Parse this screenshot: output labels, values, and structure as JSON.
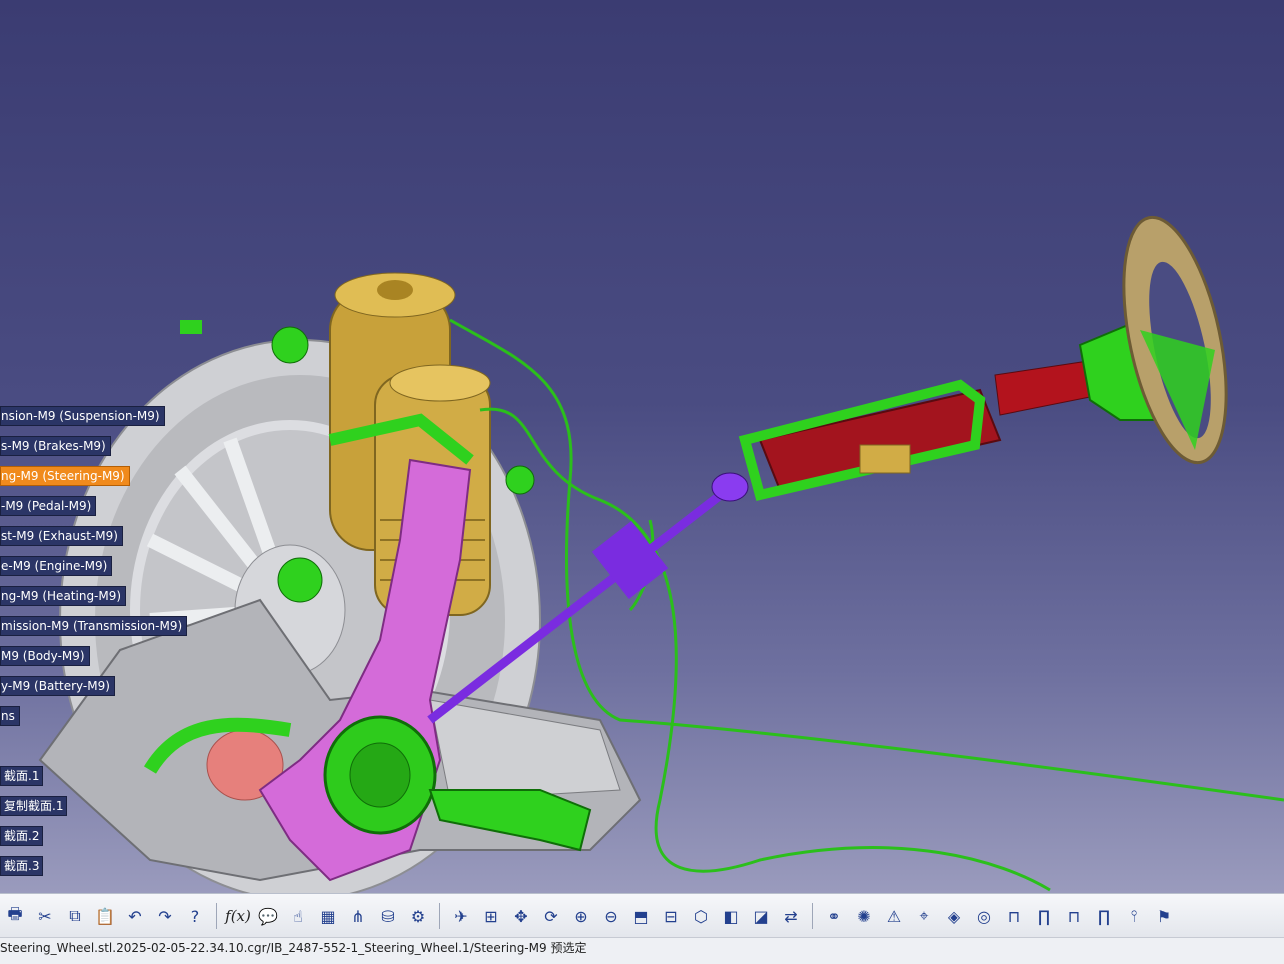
{
  "spec_tree": {
    "items": [
      {
        "label": "nsion-M9 (Suspension-M9)"
      },
      {
        "label": "s-M9 (Brakes-M9)"
      },
      {
        "label": "ng-M9 (Steering-M9)",
        "selected": true
      },
      {
        "label": "-M9 (Pedal-M9)"
      },
      {
        "label": "st-M9 (Exhaust-M9)"
      },
      {
        "label": "e-M9 (Engine-M9)"
      },
      {
        "label": "ng-M9 (Heating-M9)"
      },
      {
        "label": "mission-M9 (Transmission-M9)"
      },
      {
        "label": "M9 (Body-M9)"
      },
      {
        "label": "y-M9 (Battery-M9)"
      },
      {
        "label": "ns"
      }
    ],
    "sections": [
      {
        "label": "截面.1"
      },
      {
        "label": "复制截面.1"
      },
      {
        "label": "截面.2"
      },
      {
        "label": "截面.3"
      }
    ]
  },
  "toolbar": {
    "buttons": [
      {
        "name": "print-icon",
        "glyph": "🖶"
      },
      {
        "name": "cut-icon",
        "glyph": "✂"
      },
      {
        "name": "copy-icon",
        "glyph": "⧉"
      },
      {
        "name": "paste-icon",
        "glyph": "📋"
      },
      {
        "name": "undo-icon",
        "glyph": "↶"
      },
      {
        "name": "redo-icon",
        "glyph": "↷"
      },
      {
        "name": "whats-this-icon",
        "glyph": "?"
      },
      {
        "name": "sep"
      },
      {
        "name": "formula-icon",
        "glyph": "f(x)",
        "fx": true
      },
      {
        "name": "comment-icon",
        "glyph": "💬"
      },
      {
        "name": "hand-icon",
        "glyph": "☝"
      },
      {
        "name": "table-icon",
        "glyph": "▦"
      },
      {
        "name": "tree-icon",
        "glyph": "⋔"
      },
      {
        "name": "catalog-icon",
        "glyph": "⛁"
      },
      {
        "name": "knowledge-icon",
        "glyph": "⚙"
      },
      {
        "name": "sep"
      },
      {
        "name": "fly-mode-icon",
        "glyph": "✈"
      },
      {
        "name": "fit-all-icon",
        "glyph": "⊞"
      },
      {
        "name": "pan-icon",
        "glyph": "✥"
      },
      {
        "name": "rotate-icon",
        "glyph": "⟳"
      },
      {
        "name": "zoom-in-icon",
        "glyph": "⊕"
      },
      {
        "name": "zoom-out-icon",
        "glyph": "⊖"
      },
      {
        "name": "normal-view-icon",
        "glyph": "⬒"
      },
      {
        "name": "multi-view-icon",
        "glyph": "⊟"
      },
      {
        "name": "iso-view-icon",
        "glyph": "⬡"
      },
      {
        "name": "shading-icon",
        "glyph": "◧"
      },
      {
        "name": "hide-show-icon",
        "glyph": "◪"
      },
      {
        "name": "swap-view-icon",
        "glyph": "⇄"
      },
      {
        "name": "sep"
      },
      {
        "name": "group-icon",
        "glyph": "⚭"
      },
      {
        "name": "explode-icon",
        "glyph": "✺"
      },
      {
        "name": "clash-icon",
        "glyph": "⚠"
      },
      {
        "name": "measure-icon",
        "glyph": "⌖"
      },
      {
        "name": "sectioning-icon",
        "glyph": "◈"
      },
      {
        "name": "distance-icon",
        "glyph": "◎"
      },
      {
        "name": "magnet-icon",
        "glyph": "⊓"
      },
      {
        "name": "bracket-icon",
        "glyph": "∏"
      },
      {
        "name": "column-icon",
        "glyph": "⊓"
      },
      {
        "name": "pillar-icon",
        "glyph": "∏"
      },
      {
        "name": "pin-icon",
        "glyph": "⫯"
      },
      {
        "name": "tag-icon",
        "glyph": "⚑"
      }
    ]
  },
  "statusbar": {
    "text": "Steering_Wheel.stl.2025-02-05-22.34.10.cgr/IB_2487-552-1_Steering_Wheel.1/Steering-M9 预选定"
  },
  "colors": {
    "background_top": "#3b3c72",
    "background_bottom": "#9a9bbd",
    "selected_tree_item": "#f08a1c",
    "highlight_green": "#2fd11e",
    "link_purple": "#7a2ce0",
    "strut_gold": "#c9a53a",
    "knuckle_magenta": "#d36ad8",
    "column_red": "#a3141e"
  }
}
